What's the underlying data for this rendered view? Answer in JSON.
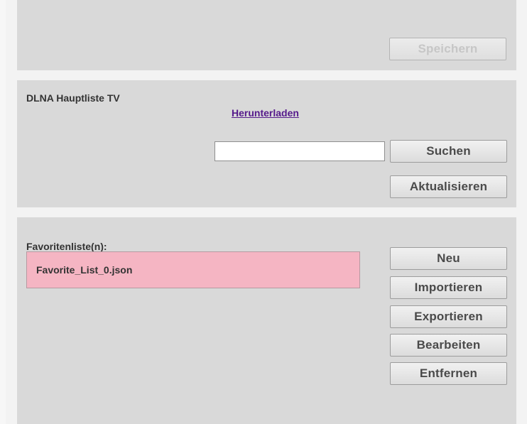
{
  "top_panel": {
    "save_label": "Speichern"
  },
  "dlna_panel": {
    "title": "DLNA Hauptliste TV",
    "download_link": "Herunterladen",
    "search": {
      "value": "",
      "placeholder": ""
    },
    "search_label": "Suchen",
    "refresh_label": "Aktualisieren"
  },
  "favorites_panel": {
    "title": "Favoritenliste(n):",
    "items": [
      {
        "label": "Favorite_List_0.json",
        "selected": true
      }
    ],
    "buttons": {
      "new_label": "Neu",
      "import_label": "Importieren",
      "export_label": "Exportieren",
      "edit_label": "Bearbeiten",
      "remove_label": "Entfernen"
    }
  },
  "colors": {
    "page_background": "#f3f3f3",
    "panel_background": "#d9d9d9",
    "selected_item_background": "#f5b5c3",
    "link_color": "#551a8b",
    "button_text": "#4a4a4a",
    "disabled_text": "#c6c6c6"
  }
}
